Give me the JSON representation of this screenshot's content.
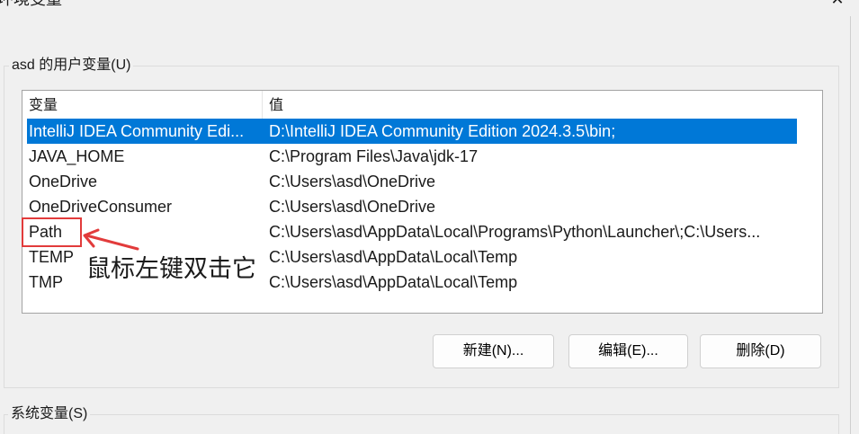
{
  "window": {
    "title": "环境变量",
    "close_icon": "close-icon",
    "close_glyph": "✕"
  },
  "user_variables": {
    "group_label": "asd 的用户变量(U)",
    "columns": {
      "name": "变量",
      "value": "值"
    },
    "rows": [
      {
        "name": "IntelliJ IDEA Community Edi...",
        "value": "D:\\IntelliJ IDEA Community Edition 2024.3.5\\bin;",
        "selected": true
      },
      {
        "name": "JAVA_HOME",
        "value": "C:\\Program Files\\Java\\jdk-17",
        "selected": false
      },
      {
        "name": "OneDrive",
        "value": "C:\\Users\\asd\\OneDrive",
        "selected": false
      },
      {
        "name": "OneDriveConsumer",
        "value": "C:\\Users\\asd\\OneDrive",
        "selected": false
      },
      {
        "name": "Path",
        "value": "C:\\Users\\asd\\AppData\\Local\\Programs\\Python\\Launcher\\;C:\\Users...",
        "selected": false
      },
      {
        "name": "TEMP",
        "value": "C:\\Users\\asd\\AppData\\Local\\Temp",
        "selected": false
      },
      {
        "name": "TMP",
        "value": "C:\\Users\\asd\\AppData\\Local\\Temp",
        "selected": false
      }
    ],
    "buttons": {
      "new": "新建(N)...",
      "edit": "编辑(E)...",
      "delete": "删除(D)"
    }
  },
  "annotation": {
    "text": "鼠标左键双击它",
    "arrow_icon": "arrow-left-icon"
  },
  "system_variables": {
    "group_label": "系统变量(S)"
  },
  "colors": {
    "background": "#f0f0f0",
    "list_background": "#ffffff",
    "selection": "#0078d7",
    "selection_text": "#ffffff",
    "annotation": "#e23b3b"
  }
}
